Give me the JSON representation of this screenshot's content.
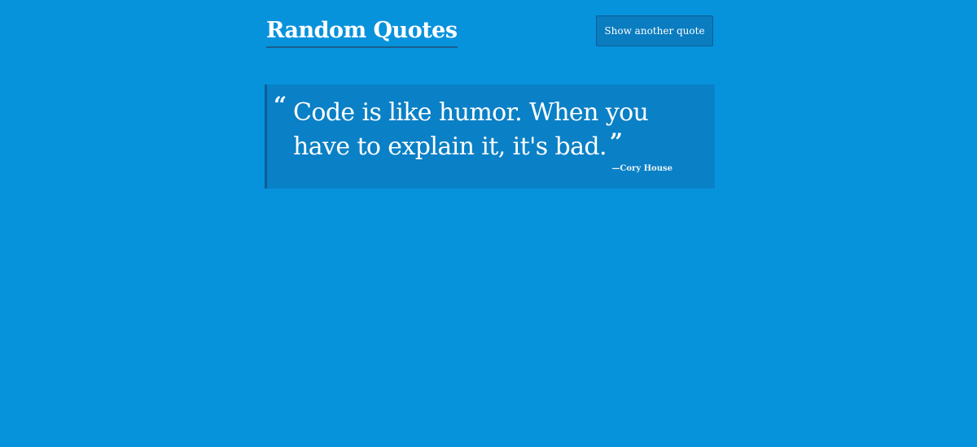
{
  "header": {
    "title": "Random Quotes",
    "button_label": "Show another quote"
  },
  "quote": {
    "open_mark": "“",
    "text": "Code is like humor. When you have to explain it, it's bad.",
    "close_mark": "”",
    "author": "—Cory House"
  },
  "colors": {
    "background": "#0793dc",
    "quote_box": "#0a80c6",
    "accent_border": "#0a5f94",
    "text": "#ffffff"
  }
}
